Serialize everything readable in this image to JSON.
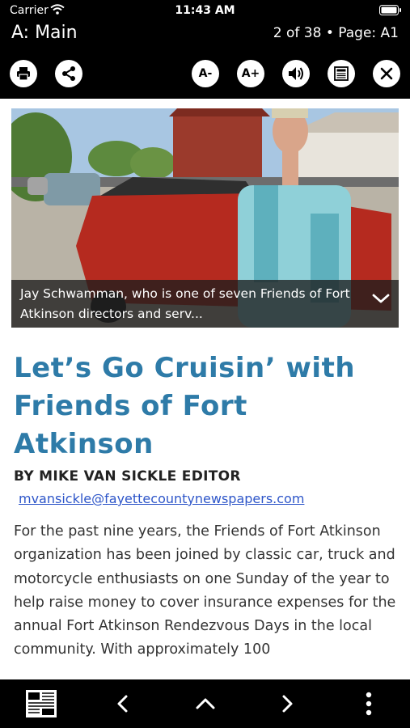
{
  "status_bar": {
    "carrier": "Carrier",
    "time": "11:43 AM"
  },
  "header": {
    "section": "A: Main",
    "page_info": "2 of 38 • Page: A1"
  },
  "toolbar": {
    "font_decrease": "A-",
    "font_increase": "A+"
  },
  "photo": {
    "caption": "Jay Schwamman, who is one of seven Friends of Fort Atkinson directors and serv..."
  },
  "article": {
    "headline": "Let’s Go Cruisin’ with Friends of Fort Atkinson",
    "byline": "BY MIKE VAN SICKLE EDITOR",
    "email": "mvansickle@fayettecountynewspapers.com",
    "body": "For the past nine years, the Friends of Fort Atkinson organization has been joined by classic car, truck and motorcycle enthusiasts on one Sunday of the year to help raise money to cover insurance expenses for the annual Fort Atkinson Rendezvous Days in the local community. With approximately 100"
  },
  "colors": {
    "headline": "#2e7ba8",
    "link": "#2e56c9",
    "bar": "#000000"
  }
}
